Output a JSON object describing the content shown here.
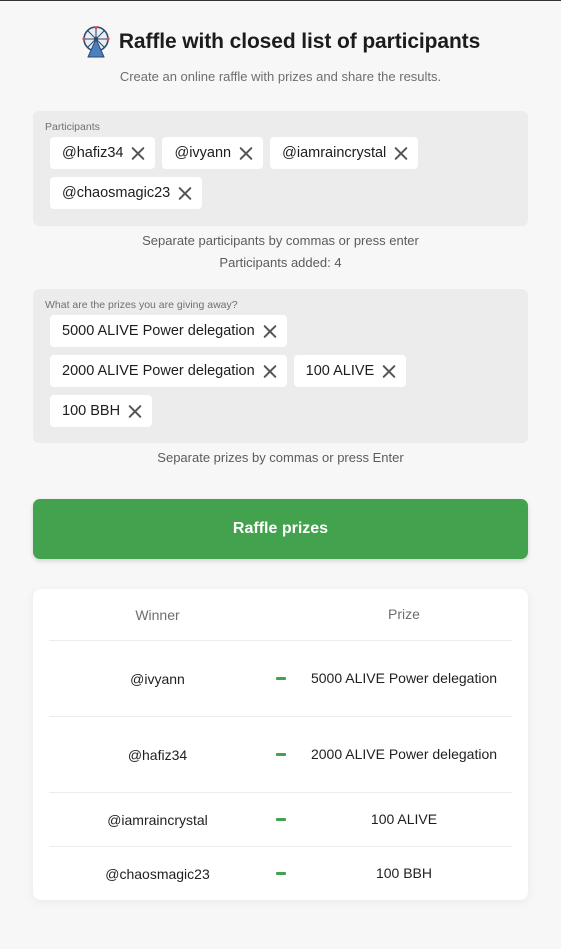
{
  "header": {
    "title": "Raffle with closed list of participants",
    "subtitle": "Create an online raffle with prizes and share the results."
  },
  "participants": {
    "label": "Participants",
    "items": [
      "@hafiz34",
      "@ivyann",
      "@iamraincrystal",
      "@chaosmagic23"
    ],
    "hint": "Separate participants by commas or press enter",
    "count_text": "Participants added: 4"
  },
  "prizes": {
    "label": "What are the prizes you are giving away?",
    "items": [
      "5000 ALIVE Power delegation",
      "2000 ALIVE Power delegation",
      "100 ALIVE",
      "100 BBH"
    ],
    "hint": "Separate prizes by commas or press Enter"
  },
  "raffle_button": {
    "label": "Raffle prizes"
  },
  "results": {
    "columns": {
      "winner": "Winner",
      "prize": "Prize"
    },
    "rows": [
      {
        "winner": "@ivyann",
        "prize": "5000 ALIVE Power delegation"
      },
      {
        "winner": "@hafiz34",
        "prize": "2000 ALIVE Power delegation"
      },
      {
        "winner": "@iamraincrystal",
        "prize": "100 ALIVE"
      },
      {
        "winner": "@chaosmagic23",
        "prize": "100 BBH"
      }
    ]
  },
  "colors": {
    "accent": "#43a24d",
    "background": "#f7f7f7",
    "input_box": "#ececec",
    "chip": "#ffffff"
  },
  "icons": {
    "logo": "ferris-wheel-icon",
    "remove": "close-icon",
    "separator": "dash-icon"
  }
}
